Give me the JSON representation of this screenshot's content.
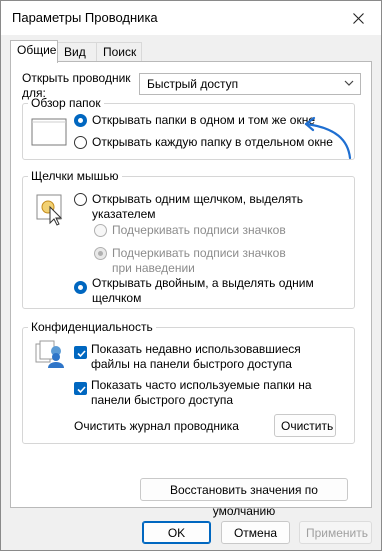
{
  "window": {
    "title": "Параметры Проводника"
  },
  "tabs": [
    "Общие",
    "Вид",
    "Поиск"
  ],
  "general": {
    "open_explorer_label": "Открыть проводник для:",
    "open_explorer_value": "Быстрый доступ",
    "browse_folders": {
      "legend": "Обзор папок",
      "same_window": "Открывать папки в одном и том же окне",
      "separate_window": "Открывать каждую папку в отдельном окне",
      "selected": "same_window"
    },
    "mouse_clicks": {
      "legend": "Щелчки мышью",
      "single_click": "Открывать одним щелчком, выделять указателем",
      "underline_always": "Подчеркивать подписи значков",
      "underline_hover": "Подчеркивать подписи значков при наведении",
      "double_click": "Открывать двойным, а выделять одним щелчком",
      "selected": "double_click"
    },
    "privacy": {
      "legend": "Конфиденциальность",
      "show_recent_files": "Показать недавно использовавшиеся файлы на панели быстрого доступа",
      "show_frequent_folders": "Показать часто используемые папки на панели быстрого доступа",
      "clear_history_label": "Очистить журнал проводника",
      "clear_button": "Очистить"
    },
    "restore_defaults": "Восстановить значения по умолчанию"
  },
  "footer": {
    "ok": "OK",
    "cancel": "Отмена",
    "apply": "Применить"
  },
  "colors": {
    "accent": "#0067c0",
    "annotation_arrow": "#1f6fd1"
  }
}
